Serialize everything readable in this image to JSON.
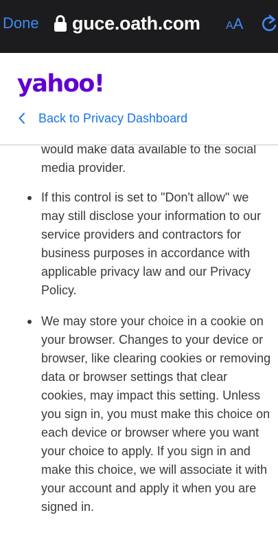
{
  "browser": {
    "done_label": "Done",
    "url": "guce.oath.com",
    "text_size_label_small": "A",
    "text_size_label_big": "A",
    "lock_icon": "lock-icon",
    "reload_icon": "reload-icon"
  },
  "header": {
    "logo_text": "yahoo!",
    "back_label": "Back to Privacy Dashboard",
    "back_icon": "chevron-left-icon",
    "brand_color": "#6001d2",
    "link_color": "#1a73e8"
  },
  "content": {
    "continued_text": "would make data available to the social media provider.",
    "bullets": [
      "If this control is set to \"Don't allow\" we may still disclose your information to our service providers and contractors for business purposes in accordance with applicable privacy law and our Privacy Policy.",
      "We may store your choice in a cookie on your browser. Changes to your device or browser, like clearing cookies or removing data or browser settings that clear cookies, may impact this setting. Unless you sign in, you must make this choice on each device or browser where you want your choice to apply. If you sign in and make this choice, we will associate it with your account and apply it when you are signed in."
    ]
  }
}
